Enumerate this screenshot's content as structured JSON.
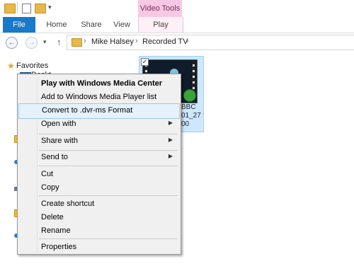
{
  "colors": {
    "accent": "#1979ca",
    "contextual_tab": "#f7c8e4",
    "selection": "#cce8ff",
    "menu_highlight": "#e5f1fb"
  },
  "titlebar": {
    "contextual_group": "Video Tools"
  },
  "ribbon": {
    "tabs": [
      "File",
      "Home",
      "Share",
      "View",
      "Play"
    ]
  },
  "nav": {
    "back_icon": "back-arrow-icon",
    "forward_icon": "forward-arrow-icon",
    "up_icon": "up-arrow-icon"
  },
  "address": {
    "crumbs": [
      "Mike Halsey",
      "Recorded TV"
    ]
  },
  "navpane": {
    "favorites": "Favorites",
    "desktop_partial": "Deskt"
  },
  "file": {
    "name_lines": [
      "BBC",
      "01_27",
      "00"
    ]
  },
  "context_menu": {
    "items": [
      {
        "label": "Play with Windows Media Center",
        "bold": true
      },
      {
        "label": "Add to Windows Media Player list"
      },
      {
        "label": "Convert to .dvr-ms Format",
        "highlighted": true
      },
      {
        "label": "Open with",
        "submenu": true
      },
      {
        "label": "Share with",
        "submenu": true
      },
      {
        "label": "Send to",
        "submenu": true
      },
      {
        "label": "Cut"
      },
      {
        "label": "Copy"
      },
      {
        "label": "Create shortcut"
      },
      {
        "label": "Delete"
      },
      {
        "label": "Rename"
      },
      {
        "label": "Properties"
      }
    ]
  }
}
